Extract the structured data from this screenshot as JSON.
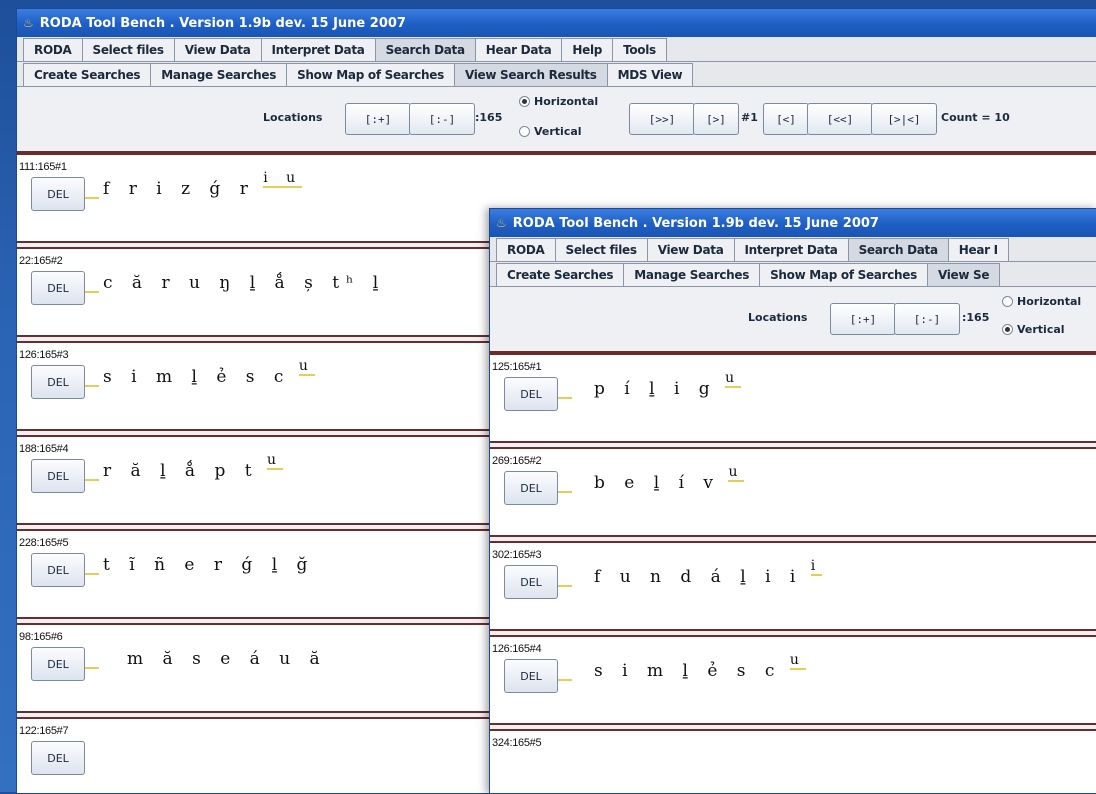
{
  "windows": [
    {
      "title": "RODA Tool Bench . Version 1.9b dev. 15 June 2007",
      "menu_tabs": [
        "RODA",
        "Select files",
        "View Data",
        "Interpret Data",
        "Search Data",
        "Hear Data",
        "Help",
        "Tools"
      ],
      "sub_tabs": [
        "Create Searches",
        "Manage Searches",
        "Show Map of Searches",
        "View Search Results",
        "MDS View"
      ],
      "controls": {
        "locations_label": "Locations",
        "plus": "[:+]",
        "minus": "[:-]",
        "total": ":165",
        "horizontal": "Horizontal",
        "vertical": "Vertical",
        "selected": "Horizontal",
        "next_end": "[>>]",
        "next": "[>]",
        "index": "#1",
        "prev": "[<]",
        "prev_start": "[<<]",
        "fit": "[>|<]",
        "count": "Count = 10"
      },
      "results": [
        {
          "id": "111:165#1",
          "del": "DEL",
          "text": "f r i z ǵ r",
          "sup": "i u"
        },
        {
          "id": "22:165#2",
          "del": "DEL",
          "text": "c ă r u ŋ ḻ ǻ ș tʰ ḻ",
          "sup": ""
        },
        {
          "id": "126:165#3",
          "del": "DEL",
          "text": "s i m ḻ ẻ s c",
          "sup": "u"
        },
        {
          "id": "188:165#4",
          "del": "DEL",
          "text": "r ă ḻ ǻ p t",
          "sup": "u"
        },
        {
          "id": "228:165#5",
          "del": "DEL",
          "text": "t ĩ ñ e r ǵ ḻ ğ",
          "sup": ""
        },
        {
          "id": "98:165#6",
          "del": "DEL",
          "text": "m ă s e á u ă",
          "sup": ""
        },
        {
          "id": "122:165#7",
          "del": "DEL",
          "text": "",
          "sup": ""
        }
      ]
    },
    {
      "title": "RODA Tool Bench . Version 1.9b dev. 15 June 2007",
      "menu_tabs": [
        "RODA",
        "Select files",
        "View Data",
        "Interpret Data",
        "Search Data",
        "Hear I"
      ],
      "sub_tabs": [
        "Create Searches",
        "Manage Searches",
        "Show Map of Searches",
        "View Se"
      ],
      "controls": {
        "locations_label": "Locations",
        "plus": "[:+]",
        "minus": "[:-]",
        "total": ":165",
        "horizontal": "Horizontal",
        "vertical": "Vertical",
        "selected": "Vertical"
      },
      "results": [
        {
          "id": "125:165#1",
          "del": "DEL",
          "text": "p í ḻ i g",
          "sup": "u"
        },
        {
          "id": "269:165#2",
          "del": "DEL",
          "text": "b e ḻ í v",
          "sup": "u"
        },
        {
          "id": "302:165#3",
          "del": "DEL",
          "text": "f u n d á ḻ i i",
          "sup": "i"
        },
        {
          "id": "126:165#4",
          "del": "DEL",
          "text": "s i m ḻ ẻ s c",
          "sup": "u"
        },
        {
          "id": "324:165#5",
          "del": "DEL",
          "text": "",
          "sup": ""
        }
      ]
    }
  ]
}
